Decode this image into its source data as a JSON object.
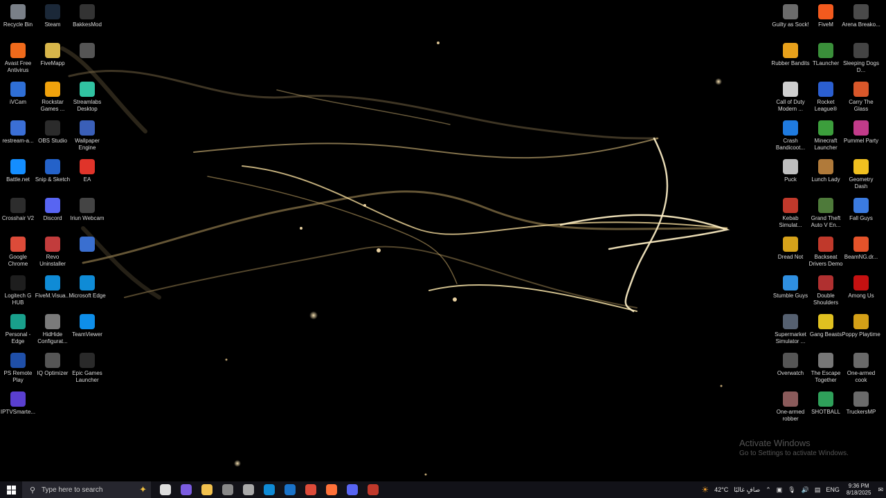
{
  "desktop_icons": [
    {
      "label": "Recycle Bin",
      "icon": "recycle-bin-icon",
      "color": "#7a8088"
    },
    {
      "label": "Steam",
      "icon": "steam-icon",
      "color": "#1b2838"
    },
    {
      "label": "BakkesMod",
      "icon": "bakkesmod-icon",
      "color": "#333333"
    },
    {
      "label": "Avast Free Antivirus",
      "icon": "avast-icon",
      "color": "#f06a1b"
    },
    {
      "label": "FiveMapp",
      "icon": "folder-icon",
      "color": "#d8b64a"
    },
    {
      "label": "",
      "icon": "file-icon",
      "color": "#555555"
    },
    {
      "label": "iVCam",
      "icon": "ivcam-icon",
      "color": "#2f6fd6"
    },
    {
      "label": "Rockstar Games ...",
      "icon": "rockstar-icon",
      "color": "#f0a20c"
    },
    {
      "label": "Streamlabs Desktop",
      "icon": "streamlabs-icon",
      "color": "#31c3a2"
    },
    {
      "label": "restream-a...",
      "icon": "app-icon",
      "color": "#3b6fd6"
    },
    {
      "label": "OBS Studio",
      "icon": "obs-icon",
      "color": "#2b2b2b"
    },
    {
      "label": "Wallpaper Engine",
      "icon": "wallpaper-engine-icon",
      "color": "#3a5fb8"
    },
    {
      "label": "Battle.net",
      "icon": "battlenet-icon",
      "color": "#148eff"
    },
    {
      "label": "Snip & Sketch",
      "icon": "snip-sketch-icon",
      "color": "#2462c9"
    },
    {
      "label": "EA",
      "icon": "ea-icon",
      "color": "#e0342a"
    },
    {
      "label": "Crosshair V2",
      "icon": "crosshair-icon",
      "color": "#2d2d2d"
    },
    {
      "label": "Discord",
      "icon": "discord-icon",
      "color": "#5865f2"
    },
    {
      "label": "Iriun Webcam",
      "icon": "iriun-webcam-icon",
      "color": "#444444"
    },
    {
      "label": "Google Chrome",
      "icon": "chrome-icon",
      "color": "#dd4b39"
    },
    {
      "label": "Revo Uninstaller",
      "icon": "revo-uninstaller-icon",
      "color": "#c23c3c"
    },
    {
      "label": "",
      "icon": "app-icon",
      "color": "#3a6fd0"
    },
    {
      "label": "Logitech G HUB",
      "icon": "logitech-icon",
      "color": "#1e1e1e"
    },
    {
      "label": "FiveM.Visua...",
      "icon": "edge-icon",
      "color": "#0f8bd6"
    },
    {
      "label": "Microsoft Edge",
      "icon": "edge-icon",
      "color": "#0f8bd6"
    },
    {
      "label": "Personal - Edge",
      "icon": "edge-icon",
      "color": "#19a08c"
    },
    {
      "label": "HidHide Configurat...",
      "icon": "hidhide-icon",
      "color": "#7a7a7a"
    },
    {
      "label": "TeamViewer",
      "icon": "teamviewer-icon",
      "color": "#0e8ee9"
    },
    {
      "label": "PS Remote Play",
      "icon": "ps-remote-play-icon",
      "color": "#1f4fa8"
    },
    {
      "label": "IQ Optimizer",
      "icon": "iq-optimizer-icon",
      "color": "#555555"
    },
    {
      "label": "Epic Games Launcher",
      "icon": "epic-games-icon",
      "color": "#2a2a2a"
    },
    {
      "label": "IPTVSmarte...",
      "icon": "iptv-icon",
      "color": "#5a3fd0"
    },
    {
      "label": "Guilty as Sock!",
      "icon": "game-icon",
      "color": "#6b6b6b"
    },
    {
      "label": "FiveM",
      "icon": "fivem-icon",
      "color": "#f25a1e"
    },
    {
      "label": "Arena Breako...",
      "icon": "game-icon",
      "color": "#4a4a4a"
    },
    {
      "label": "Rubber Bandits",
      "icon": "game-icon",
      "color": "#e8a11b"
    },
    {
      "label": "TLauncher",
      "icon": "tlauncher-icon",
      "color": "#3a8f3a"
    },
    {
      "label": "Sleeping Dogs D...",
      "icon": "game-icon",
      "color": "#444444"
    },
    {
      "label": "Call of Duty Modern ...",
      "icon": "file-icon",
      "color": "#cfcfcf"
    },
    {
      "label": "Rocket League®",
      "icon": "rocket-league-icon",
      "color": "#2b5fd0"
    },
    {
      "label": "Carry The Glass",
      "icon": "game-icon",
      "color": "#d8572a"
    },
    {
      "label": "Crash Bandicoot...",
      "icon": "game-icon",
      "color": "#1f7be0"
    },
    {
      "label": "Minecraft Launcher",
      "icon": "minecraft-icon",
      "color": "#3c9e3c"
    },
    {
      "label": "Pummel Party",
      "icon": "game-icon",
      "color": "#c23b8a"
    },
    {
      "label": "Puck",
      "icon": "game-icon",
      "color": "#bfbfbf"
    },
    {
      "label": "Lunch Lady",
      "icon": "game-icon",
      "color": "#b07a3a"
    },
    {
      "label": "Geometry Dash",
      "icon": "geometry-dash-icon",
      "color": "#f0c020"
    },
    {
      "label": "Kebab Simulat...",
      "icon": "game-icon",
      "color": "#c0392b"
    },
    {
      "label": "Grand Theft Auto V En...",
      "icon": "gta-icon",
      "color": "#4e7a3a"
    },
    {
      "label": "Fall Guys",
      "icon": "fall-guys-icon",
      "color": "#3b7be0"
    },
    {
      "label": "Dread Not",
      "icon": "game-icon",
      "color": "#d6a21a"
    },
    {
      "label": "Backseat Drivers Demo",
      "icon": "game-icon",
      "color": "#c0392b"
    },
    {
      "label": "BeamNG.dr...",
      "icon": "beamng-icon",
      "color": "#e5532a"
    },
    {
      "label": "Stumble Guys",
      "icon": "game-icon",
      "color": "#2f8fe0"
    },
    {
      "label": "Double Shoulders",
      "icon": "game-icon",
      "color": "#b03030"
    },
    {
      "label": "Among Us",
      "icon": "among-us-icon",
      "color": "#c51111"
    },
    {
      "label": "Supermarket Simulator ...",
      "icon": "game-icon",
      "color": "#556070"
    },
    {
      "label": "Gang Beasts",
      "icon": "game-icon",
      "color": "#e0c020"
    },
    {
      "label": "Poppy Playtime",
      "icon": "game-icon",
      "color": "#d4a017"
    },
    {
      "label": "Overwatch",
      "icon": "overwatch-icon",
      "color": "#555555"
    },
    {
      "label": "The Escape Together",
      "icon": "game-icon",
      "color": "#777777"
    },
    {
      "label": "One-armed cook",
      "icon": "game-icon",
      "color": "#6a6a6a"
    },
    {
      "label": "One-armed robber",
      "icon": "game-icon",
      "color": "#8a5a5a"
    },
    {
      "label": "SHOTBALL",
      "icon": "game-icon",
      "color": "#2fa05a"
    },
    {
      "label": "TruckersMP",
      "icon": "truckersmp-icon",
      "color": "#6a6a6a"
    }
  ],
  "watermark": {
    "title": "Activate Windows",
    "subtitle": "Go to Settings to activate Windows."
  },
  "taskbar": {
    "start_icon": "windows-start-icon",
    "search_placeholder": "Type here to search",
    "apps": [
      {
        "icon": "task-view-icon",
        "color": "#dddddd"
      },
      {
        "icon": "copilot-icon",
        "color": "#7b5ce0"
      },
      {
        "icon": "file-explorer-icon",
        "color": "#f2c14e"
      },
      {
        "icon": "calculator-icon",
        "color": "#888888"
      },
      {
        "icon": "gaming-app-icon",
        "color": "#aaaaaa"
      },
      {
        "icon": "edge-icon",
        "color": "#0f8bd6"
      },
      {
        "icon": "outlook-icon",
        "color": "#1a73c9"
      },
      {
        "icon": "chrome-icon",
        "color": "#dd4b39"
      },
      {
        "icon": "firefox-icon",
        "color": "#ff7139"
      },
      {
        "icon": "discord-icon",
        "color": "#5865f2"
      },
      {
        "icon": "app-icon",
        "color": "#c0392b"
      }
    ],
    "weather": "42°C",
    "weather_desc": "صافٍ غالبًا",
    "language": "ENG",
    "time": "9:36 PM",
    "date": "8/18/2025"
  }
}
